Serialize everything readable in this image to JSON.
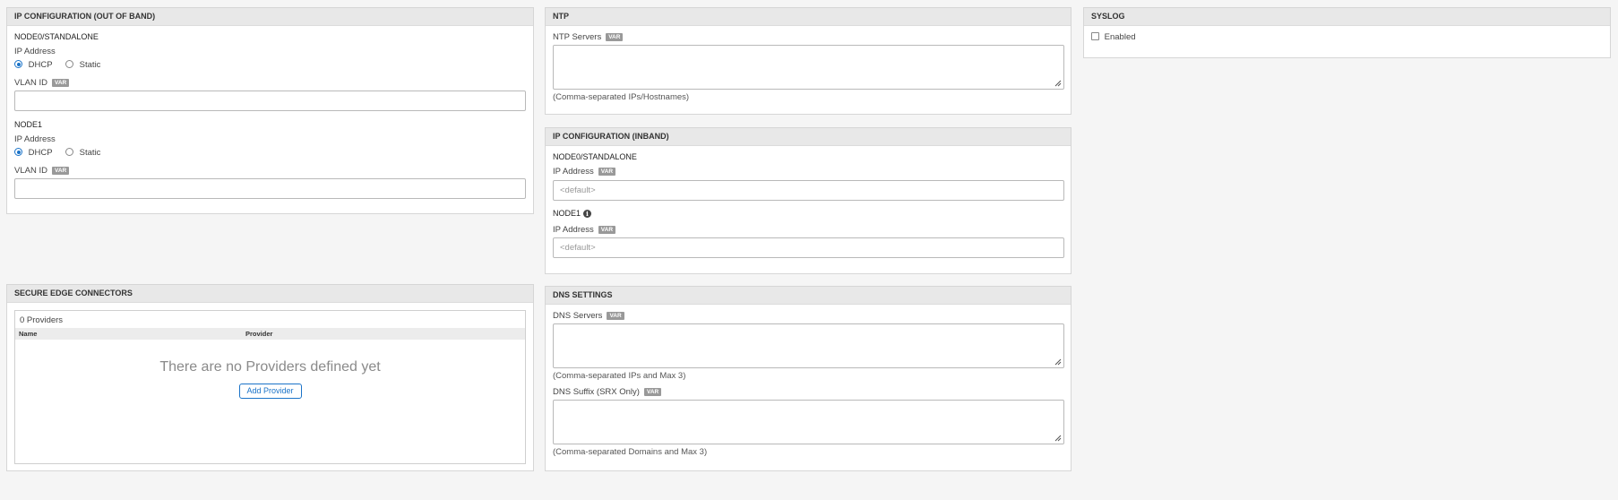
{
  "oob": {
    "title": "IP CONFIGURATION (OUT OF BAND)",
    "node0": {
      "title": "NODE0/STANDALONE",
      "ip_label": "IP Address",
      "dhcp_label": "DHCP",
      "static_label": "Static",
      "selected": "DHCP",
      "vlan_label": "VLAN ID",
      "vlan_value": ""
    },
    "node1": {
      "title": "NODE1",
      "ip_label": "IP Address",
      "dhcp_label": "DHCP",
      "static_label": "Static",
      "selected": "DHCP",
      "vlan_label": "VLAN ID",
      "vlan_value": ""
    }
  },
  "var_badge": "VAR",
  "ntp": {
    "title": "NTP",
    "servers_label": "NTP Servers",
    "servers_value": "",
    "hint": "(Comma-separated IPs/Hostnames)"
  },
  "syslog": {
    "title": "SYSLOG",
    "enabled_label": "Enabled",
    "enabled": false
  },
  "inband": {
    "title": "IP CONFIGURATION (INBAND)",
    "node0": {
      "title": "NODE0/STANDALONE",
      "ip_label": "IP Address",
      "ip_placeholder": "<default>"
    },
    "node1": {
      "title": "NODE1",
      "ip_label": "IP Address",
      "ip_placeholder": "<default>"
    }
  },
  "sec": {
    "title": "SECURE EDGE CONNECTORS",
    "count_text": "0 Providers",
    "columns": [
      "Name",
      "Provider"
    ],
    "empty_message": "There are no Providers defined yet",
    "add_button": "Add Provider"
  },
  "dns": {
    "title": "DNS SETTINGS",
    "servers_label": "DNS Servers",
    "servers_value": "",
    "servers_hint": "(Comma-separated IPs and Max 3)",
    "suffix_label": "DNS Suffix (SRX Only)",
    "suffix_value": "",
    "suffix_hint": "(Comma-separated Domains and Max 3)"
  },
  "colors": {
    "accent": "#1a73c8",
    "badge": "#999999",
    "panel_header": "#e8e8e8"
  }
}
